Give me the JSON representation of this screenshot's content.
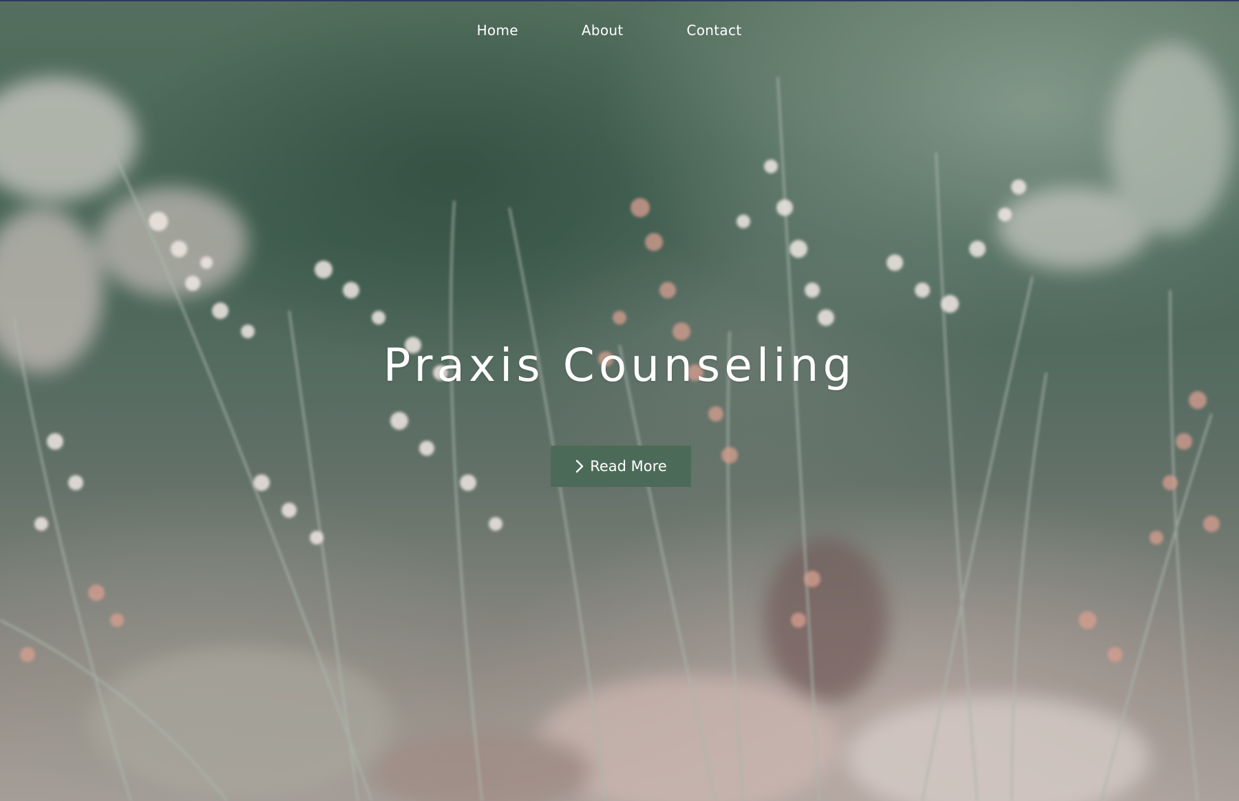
{
  "nav": {
    "items": [
      {
        "label": "Home"
      },
      {
        "label": "About"
      },
      {
        "label": "Contact"
      }
    ]
  },
  "hero": {
    "title": "Praxis Counseling",
    "button_label": "Read More",
    "button_icon": "chevron-right-icon",
    "button_color": "#4c6a58",
    "background_image": "blurred meadow grass with pale pink seed heads"
  }
}
